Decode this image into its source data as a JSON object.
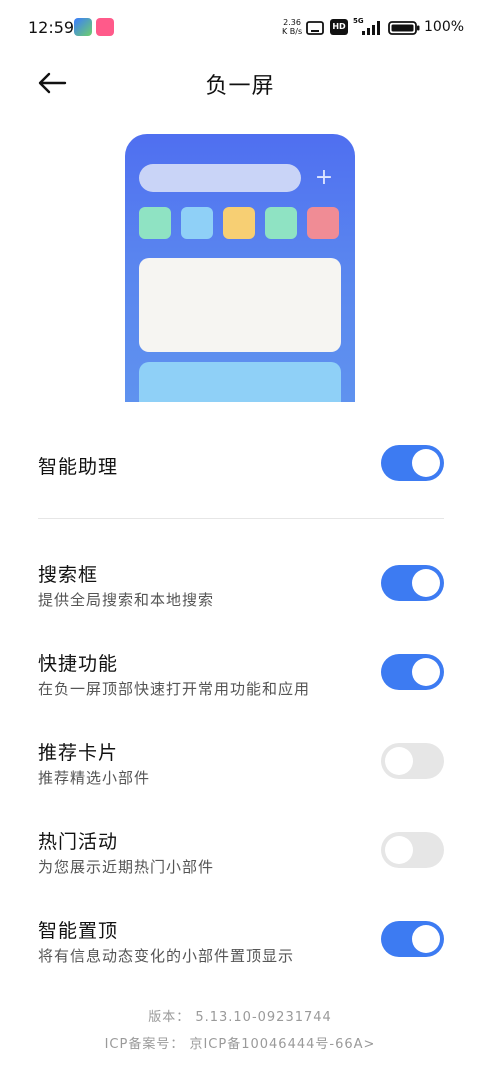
{
  "status_bar": {
    "time": "12:59",
    "net_speed_value": "2.36",
    "net_speed_unit": "K B/s",
    "hd_label": "HD",
    "network_label": "5G",
    "battery_text": "100%"
  },
  "header": {
    "title": "负一屏",
    "back_icon": "arrow-left-icon"
  },
  "preview": {
    "plus_symbol": "+",
    "tile_colors": [
      "#8fe3c3",
      "#8fd0f7",
      "#f7cf73",
      "#8fe3c3",
      "#f08c95"
    ]
  },
  "settings": [
    {
      "id": "smart-assistant",
      "title": "智能助理",
      "subtitle": "",
      "enabled": true
    },
    {
      "id": "search-box",
      "title": "搜索框",
      "subtitle": "提供全局搜索和本地搜索",
      "enabled": true
    },
    {
      "id": "shortcuts",
      "title": "快捷功能",
      "subtitle": "在负一屏顶部快速打开常用功能和应用",
      "enabled": true
    },
    {
      "id": "recommended-cards",
      "title": "推荐卡片",
      "subtitle": "推荐精选小部件",
      "enabled": false
    },
    {
      "id": "hot-activities",
      "title": "热门活动",
      "subtitle": "为您展示近期热门小部件",
      "enabled": false
    },
    {
      "id": "smart-pin",
      "title": "智能置顶",
      "subtitle": "将有信息动态变化的小部件置顶显示",
      "enabled": true
    }
  ],
  "footer": {
    "version": "版本：  5.13.10-09231744",
    "icp": "ICP备案号：  京ICP备10046444号-66A>"
  },
  "colors": {
    "accent": "#3d7bf2",
    "toggle_off": "#e6e6e6"
  }
}
